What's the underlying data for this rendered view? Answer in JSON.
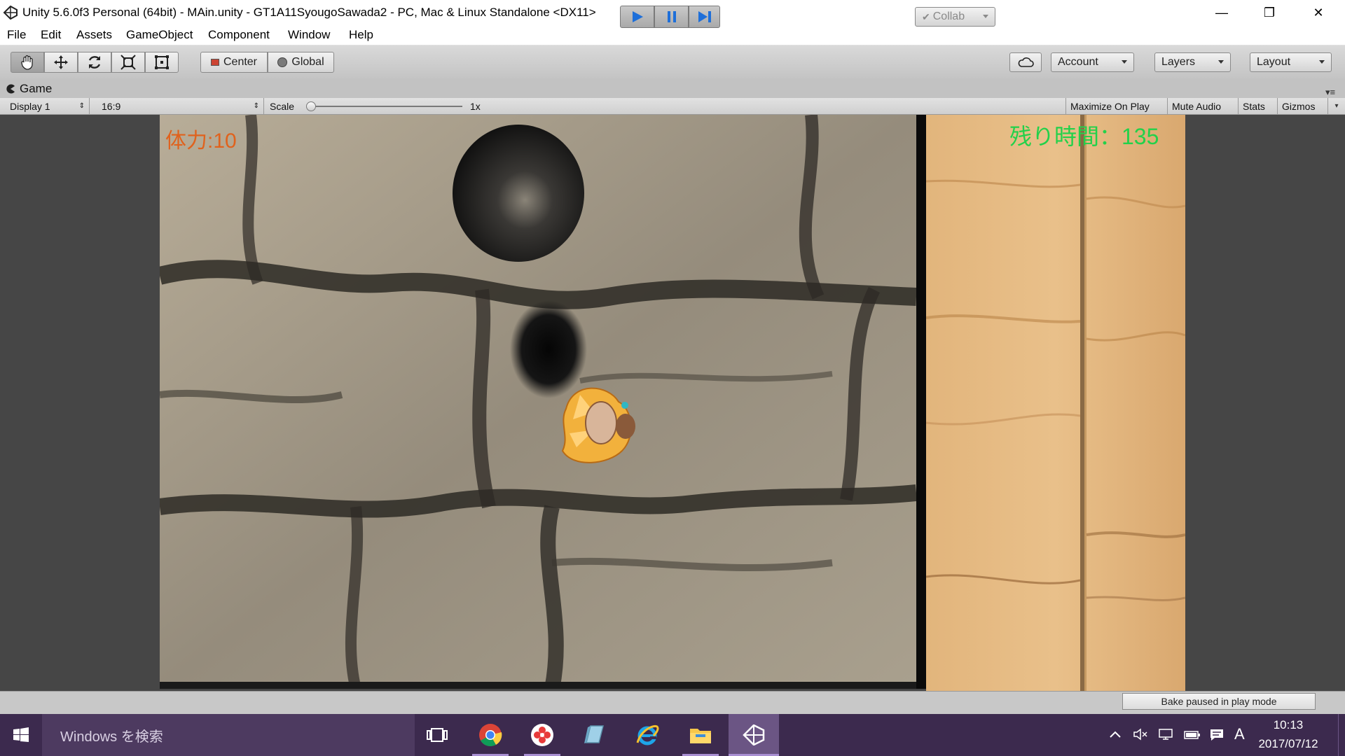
{
  "window": {
    "title": "Unity 5.6.0f3 Personal (64bit) - MAin.unity - GT1A11SyougoSawada2 - PC, Mac & Linux Standalone <DX11>",
    "minimize_glyph": "—",
    "restore_glyph": "❐",
    "close_glyph": "✕"
  },
  "menu": [
    "File",
    "Edit",
    "Assets",
    "GameObject",
    "Component",
    "Window",
    "Help"
  ],
  "toolbar": {
    "tools": [
      "hand-tool-icon",
      "move-tool-icon",
      "rotate-tool-icon",
      "scale-tool-icon",
      "rect-tool-icon"
    ],
    "pivot_label": "Center",
    "space_label": "Global",
    "collab_label": "Collab",
    "account_label": "Account",
    "layers_label": "Layers",
    "layout_label": "Layout",
    "play_color": "#1e6fd9"
  },
  "game_view": {
    "tab_label": "Game",
    "display_label": "Display 1",
    "aspect_label": "16:9",
    "scale_label": "Scale",
    "scale_value": "1x",
    "maximize_label": "Maximize On Play",
    "mute_label": "Mute Audio",
    "stats_label": "Stats",
    "gizmos_label": "Gizmos"
  },
  "hud": {
    "hp_text": "体力:10",
    "hp_color": "#e0621d",
    "time_text": "残り時間：135",
    "time_color": "#22d14a"
  },
  "status": {
    "bake_text": "Bake paused in play mode"
  },
  "taskbar": {
    "search_placeholder": "Windows を検索",
    "apps": [
      "task-view-icon",
      "chrome-icon",
      "app-flower-icon",
      "app-paper-icon",
      "internet-explorer-icon",
      "file-explorer-icon",
      "unity-icon"
    ],
    "tray_ime": "A",
    "clock_time": "10:13",
    "clock_date": "2017/07/12"
  }
}
